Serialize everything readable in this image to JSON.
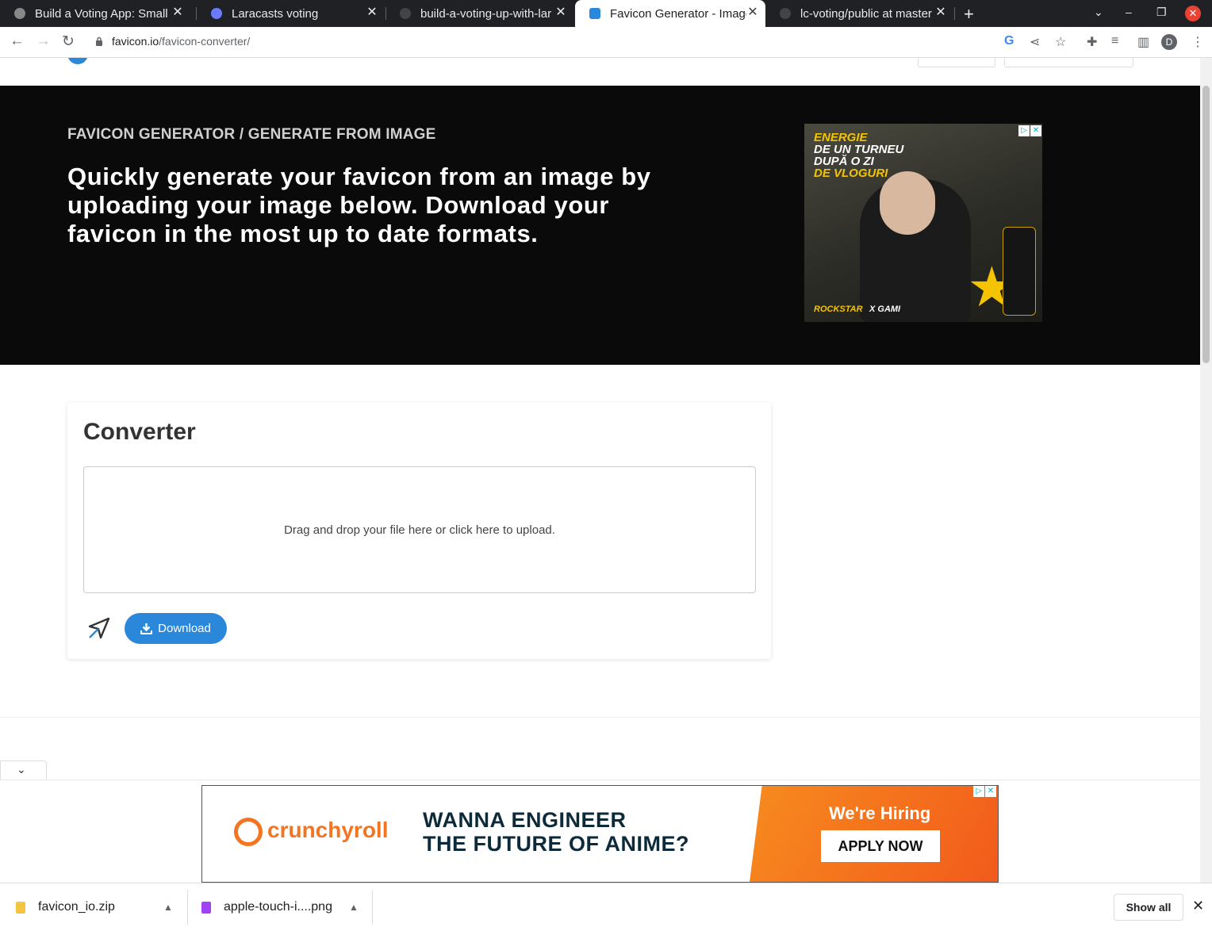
{
  "browser": {
    "tabs": [
      {
        "title": "Build a Voting App: Small",
        "close": "✕"
      },
      {
        "title": "Laracasts voting",
        "close": "✕"
      },
      {
        "title": "build-a-voting-up-with-lar",
        "close": "✕"
      },
      {
        "title": "Favicon Generator - Image",
        "close": "✕"
      },
      {
        "title": "lc-voting/public at master",
        "close": "✕"
      }
    ],
    "new_tab": "+",
    "url_host": "favicon.io",
    "url_path": "/favicon-converter/",
    "profile_initial": "D"
  },
  "hero": {
    "breadcrumb": "FAVICON GENERATOR / GENERATE FROM IMAGE",
    "title": "Quickly generate your favicon from an image by uploading your image below. Download your favicon in the most up to date formats."
  },
  "ad_top": {
    "line1": "ENERGIE",
    "line2": "DE UN TURNEU",
    "line3": "DUPĂ O ZI",
    "line4": "DE VLOGURI",
    "brand": "ROCKSTAR",
    "collab": "X  GAMI"
  },
  "converter": {
    "title": "Converter",
    "dropzone_text": "Drag and drop your file here or click here to upload.",
    "download_label": "Download"
  },
  "ad_bottom": {
    "brand": "crunchyroll",
    "headline_1": "WANNA ENGINEER",
    "headline_2": "THE FUTURE OF ANIME?",
    "hiring": "We're Hiring",
    "cta": "APPLY NOW"
  },
  "downloads": {
    "items": [
      {
        "name": "favicon_io.zip"
      },
      {
        "name": "apple-touch-i....png"
      }
    ],
    "show_all": "Show all"
  }
}
